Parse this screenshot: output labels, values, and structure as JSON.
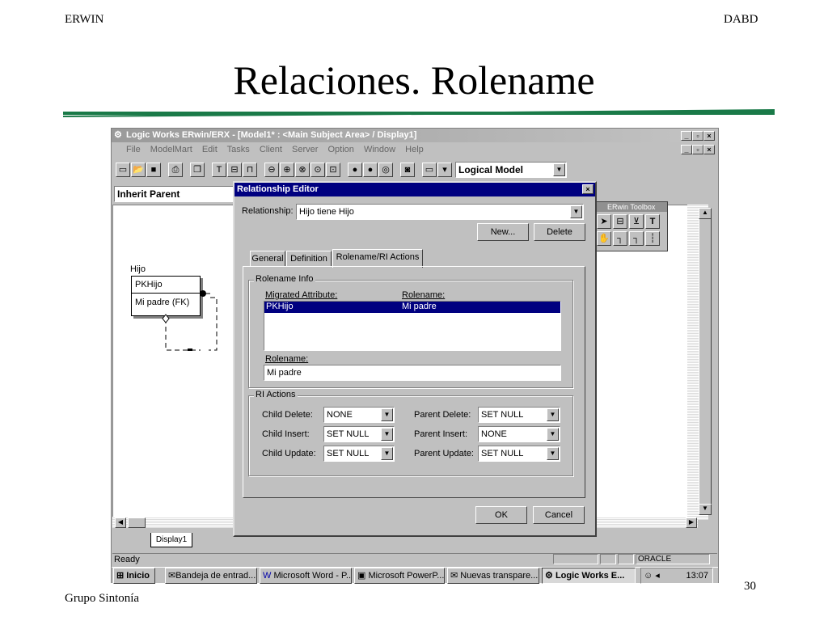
{
  "slide": {
    "header_left": "ERWIN",
    "header_right": "DABD",
    "title": "Relaciones. Rolename",
    "footer_left": "Grupo Sintonía",
    "page_number": "30"
  },
  "app": {
    "title": "Logic Works ERwin/ERX - [Model1* : <Main Subject Area> / Display1]",
    "menu": [
      "File",
      "ModelMart",
      "Edit",
      "Tasks",
      "Client",
      "Server",
      "Option",
      "Window",
      "Help"
    ],
    "model_select": "Logical Model",
    "inherit_select": "Inherit Parent",
    "toolbox_title": "ERwin Toolbox",
    "status_left": "Ready",
    "status_db": "ORACLE",
    "display_tab": "Display1"
  },
  "diagram": {
    "entity_name": "Hijo",
    "pk": "PKHijo",
    "attr": "Mi padre (FK)"
  },
  "dialog": {
    "title": "Relationship Editor",
    "relationship_label": "Relationship:",
    "relationship_value": "Hijo tiene Hijo",
    "new_button": "New...",
    "delete_button": "Delete",
    "tabs": [
      "General",
      "Definition",
      "Rolename/RI Actions"
    ],
    "rolename_group": "Rolename Info",
    "col_migrated": "Migrated Attribute:",
    "col_rolename": "Rolename:",
    "row_attr": "PKHijo",
    "row_role": "Mi padre",
    "rolename_label": "Rolename:",
    "rolename_value": "Mi padre",
    "ri_group": "RI Actions",
    "child_delete_label": "Child Delete:",
    "child_delete_value": "NONE",
    "child_insert_label": "Child Insert:",
    "child_insert_value": "SET NULL",
    "child_update_label": "Child Update:",
    "child_update_value": "SET NULL",
    "parent_delete_label": "Parent Delete:",
    "parent_delete_value": "SET NULL",
    "parent_insert_label": "Parent Insert:",
    "parent_insert_value": "NONE",
    "parent_update_label": "Parent Update:",
    "parent_update_value": "SET NULL",
    "ok_button": "OK",
    "cancel_button": "Cancel"
  },
  "taskbar": {
    "start": "Inicio",
    "items": [
      "Bandeja de entrad...",
      "Microsoft Word - P...",
      "Microsoft PowerP...",
      "Nuevas transpare...",
      "Logic Works E..."
    ],
    "clock": "13:07"
  }
}
